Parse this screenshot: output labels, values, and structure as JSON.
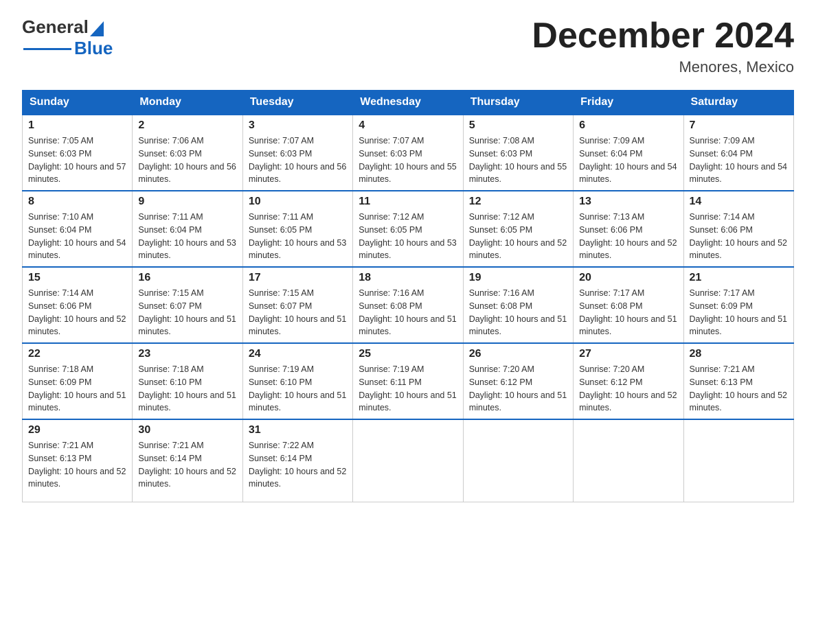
{
  "logo": {
    "general": "General",
    "blue": "Blue",
    "triangle_color": "#1565c0"
  },
  "title": "December 2024",
  "subtitle": "Menores, Mexico",
  "days_of_week": [
    "Sunday",
    "Monday",
    "Tuesday",
    "Wednesday",
    "Thursday",
    "Friday",
    "Saturday"
  ],
  "weeks": [
    [
      {
        "day": "1",
        "sunrise": "7:05 AM",
        "sunset": "6:03 PM",
        "daylight": "10 hours and 57 minutes."
      },
      {
        "day": "2",
        "sunrise": "7:06 AM",
        "sunset": "6:03 PM",
        "daylight": "10 hours and 56 minutes."
      },
      {
        "day": "3",
        "sunrise": "7:07 AM",
        "sunset": "6:03 PM",
        "daylight": "10 hours and 56 minutes."
      },
      {
        "day": "4",
        "sunrise": "7:07 AM",
        "sunset": "6:03 PM",
        "daylight": "10 hours and 55 minutes."
      },
      {
        "day": "5",
        "sunrise": "7:08 AM",
        "sunset": "6:03 PM",
        "daylight": "10 hours and 55 minutes."
      },
      {
        "day": "6",
        "sunrise": "7:09 AM",
        "sunset": "6:04 PM",
        "daylight": "10 hours and 54 minutes."
      },
      {
        "day": "7",
        "sunrise": "7:09 AM",
        "sunset": "6:04 PM",
        "daylight": "10 hours and 54 minutes."
      }
    ],
    [
      {
        "day": "8",
        "sunrise": "7:10 AM",
        "sunset": "6:04 PM",
        "daylight": "10 hours and 54 minutes."
      },
      {
        "day": "9",
        "sunrise": "7:11 AM",
        "sunset": "6:04 PM",
        "daylight": "10 hours and 53 minutes."
      },
      {
        "day": "10",
        "sunrise": "7:11 AM",
        "sunset": "6:05 PM",
        "daylight": "10 hours and 53 minutes."
      },
      {
        "day": "11",
        "sunrise": "7:12 AM",
        "sunset": "6:05 PM",
        "daylight": "10 hours and 53 minutes."
      },
      {
        "day": "12",
        "sunrise": "7:12 AM",
        "sunset": "6:05 PM",
        "daylight": "10 hours and 52 minutes."
      },
      {
        "day": "13",
        "sunrise": "7:13 AM",
        "sunset": "6:06 PM",
        "daylight": "10 hours and 52 minutes."
      },
      {
        "day": "14",
        "sunrise": "7:14 AM",
        "sunset": "6:06 PM",
        "daylight": "10 hours and 52 minutes."
      }
    ],
    [
      {
        "day": "15",
        "sunrise": "7:14 AM",
        "sunset": "6:06 PM",
        "daylight": "10 hours and 52 minutes."
      },
      {
        "day": "16",
        "sunrise": "7:15 AM",
        "sunset": "6:07 PM",
        "daylight": "10 hours and 51 minutes."
      },
      {
        "day": "17",
        "sunrise": "7:15 AM",
        "sunset": "6:07 PM",
        "daylight": "10 hours and 51 minutes."
      },
      {
        "day": "18",
        "sunrise": "7:16 AM",
        "sunset": "6:08 PM",
        "daylight": "10 hours and 51 minutes."
      },
      {
        "day": "19",
        "sunrise": "7:16 AM",
        "sunset": "6:08 PM",
        "daylight": "10 hours and 51 minutes."
      },
      {
        "day": "20",
        "sunrise": "7:17 AM",
        "sunset": "6:08 PM",
        "daylight": "10 hours and 51 minutes."
      },
      {
        "day": "21",
        "sunrise": "7:17 AM",
        "sunset": "6:09 PM",
        "daylight": "10 hours and 51 minutes."
      }
    ],
    [
      {
        "day": "22",
        "sunrise": "7:18 AM",
        "sunset": "6:09 PM",
        "daylight": "10 hours and 51 minutes."
      },
      {
        "day": "23",
        "sunrise": "7:18 AM",
        "sunset": "6:10 PM",
        "daylight": "10 hours and 51 minutes."
      },
      {
        "day": "24",
        "sunrise": "7:19 AM",
        "sunset": "6:10 PM",
        "daylight": "10 hours and 51 minutes."
      },
      {
        "day": "25",
        "sunrise": "7:19 AM",
        "sunset": "6:11 PM",
        "daylight": "10 hours and 51 minutes."
      },
      {
        "day": "26",
        "sunrise": "7:20 AM",
        "sunset": "6:12 PM",
        "daylight": "10 hours and 51 minutes."
      },
      {
        "day": "27",
        "sunrise": "7:20 AM",
        "sunset": "6:12 PM",
        "daylight": "10 hours and 52 minutes."
      },
      {
        "day": "28",
        "sunrise": "7:21 AM",
        "sunset": "6:13 PM",
        "daylight": "10 hours and 52 minutes."
      }
    ],
    [
      {
        "day": "29",
        "sunrise": "7:21 AM",
        "sunset": "6:13 PM",
        "daylight": "10 hours and 52 minutes."
      },
      {
        "day": "30",
        "sunrise": "7:21 AM",
        "sunset": "6:14 PM",
        "daylight": "10 hours and 52 minutes."
      },
      {
        "day": "31",
        "sunrise": "7:22 AM",
        "sunset": "6:14 PM",
        "daylight": "10 hours and 52 minutes."
      },
      null,
      null,
      null,
      null
    ]
  ]
}
